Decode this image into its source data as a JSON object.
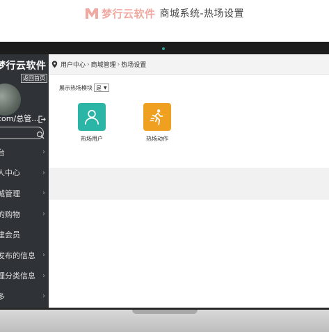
{
  "banner": {
    "brand": "梦行云软件",
    "title": "商城系统-热场设置"
  },
  "sidebar": {
    "brand": "梦行云软件",
    "home_link": "返回首页",
    "user": "com/总管...",
    "items": [
      {
        "label": "台"
      },
      {
        "label": "人中心"
      },
      {
        "label": "城管理"
      },
      {
        "label": "的购物"
      },
      {
        "label": "建会员"
      },
      {
        "label": "发布的信息"
      },
      {
        "label": "理分类信息"
      },
      {
        "label": "多"
      }
    ]
  },
  "breadcrumb": {
    "items": [
      "用户中心",
      "商城管理",
      "热场设置"
    ],
    "separator": "›"
  },
  "panel": {
    "show_label": "展示热场模块",
    "select_value": "是",
    "tiles": [
      {
        "label": "热场用户",
        "color": "#2bb5a6",
        "icon": "user-icon"
      },
      {
        "label": "热场动作",
        "color": "#f0a020",
        "icon": "running-icon"
      }
    ]
  },
  "colors": {
    "sidebar_bg": "#2f3337",
    "teal": "#2bb5a6",
    "orange": "#f0a020",
    "brand_pink": "#f0a8a0"
  }
}
